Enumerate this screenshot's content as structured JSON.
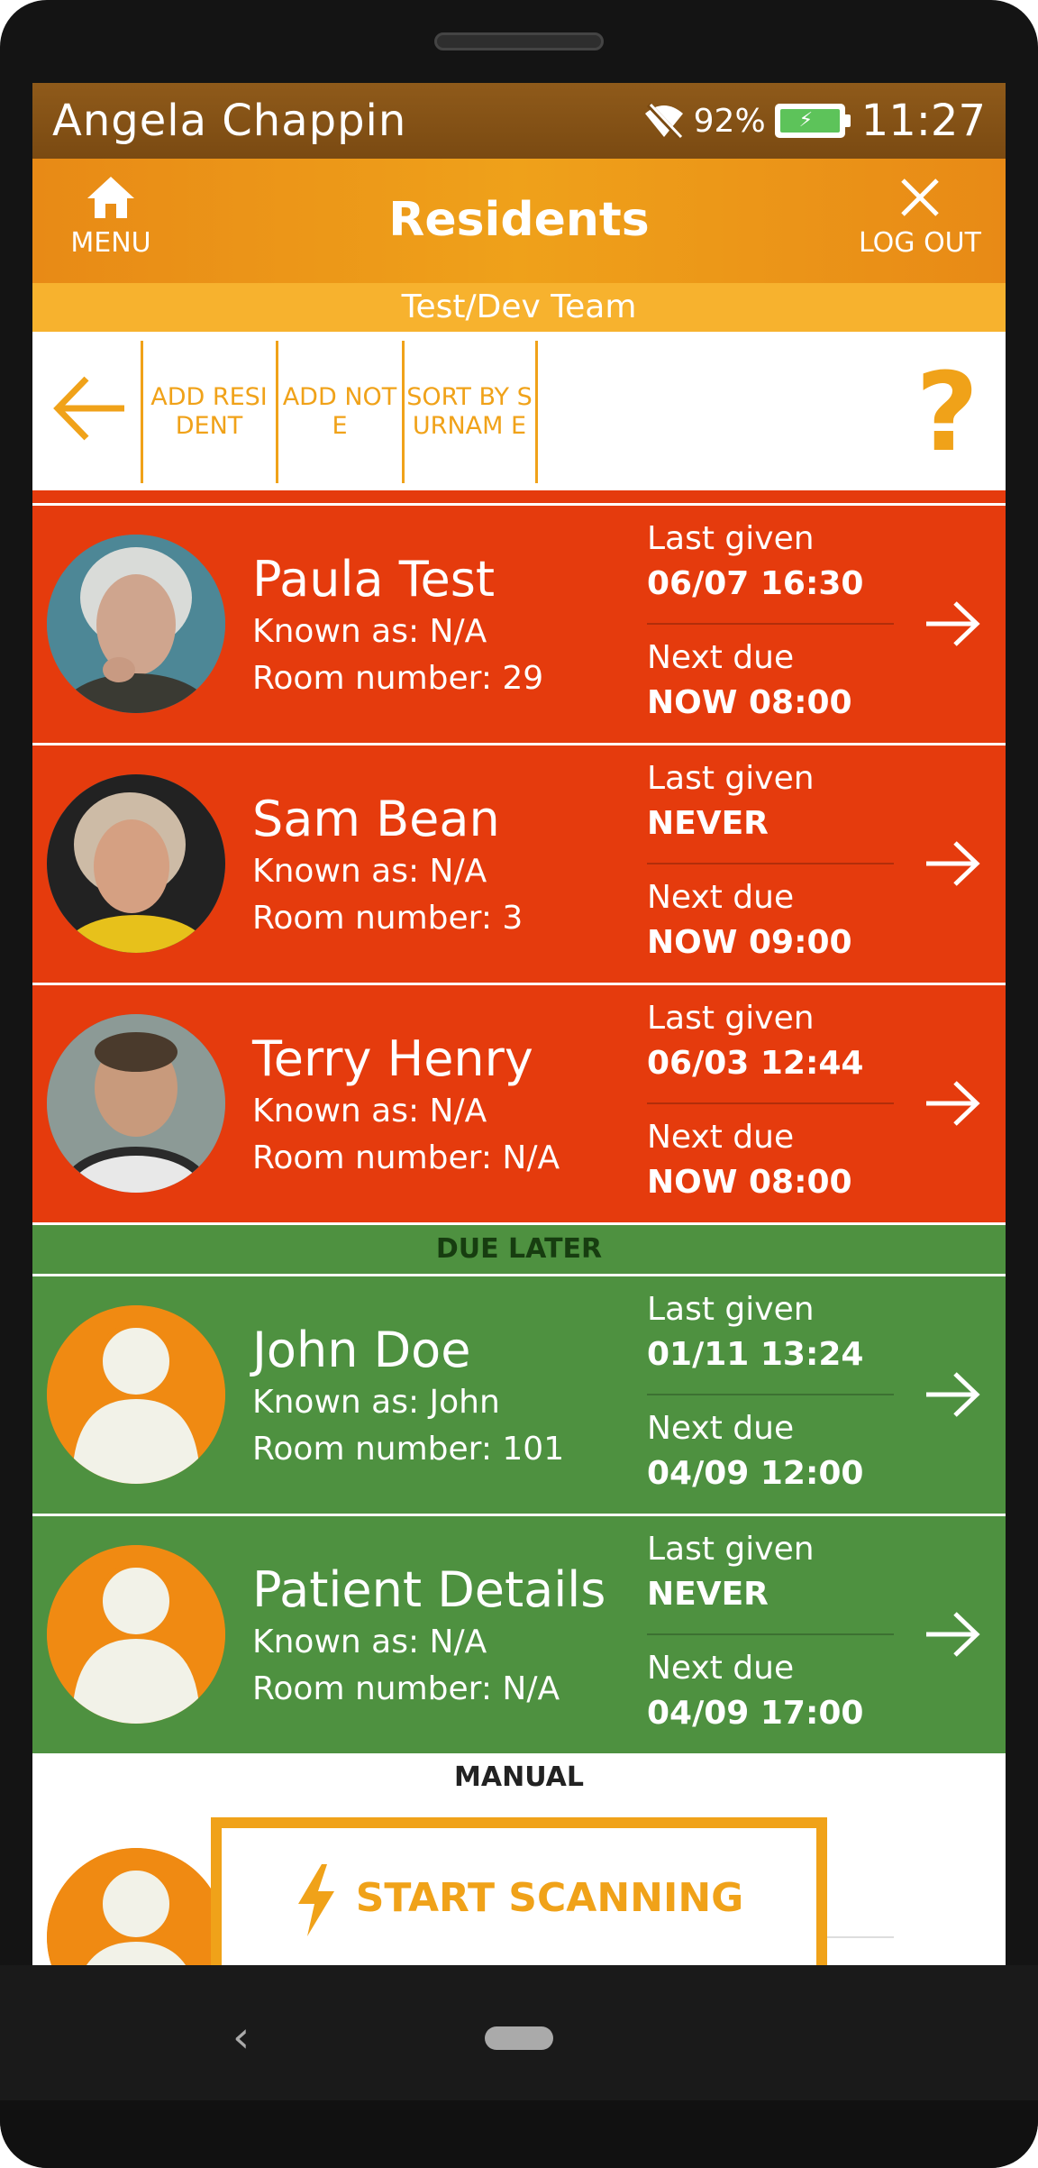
{
  "status_bar": {
    "user_name": "Angela Chappin",
    "battery": "92%",
    "time": "11:27"
  },
  "app_bar": {
    "menu_label": "MENU",
    "title": "Residents",
    "logout_label": "LOG OUT"
  },
  "team_label": "Test/Dev Team",
  "toolbar": {
    "add_resident": "ADD RESI DENT",
    "add_note": "ADD NOTE",
    "sort_by_surname": "SORT BY SURNAM E",
    "help": "?"
  },
  "overdue": [
    {
      "name": "Paula Test",
      "known_as": "Known as: N/A",
      "room": "Room number: 29",
      "last_given_label": "Last given",
      "last_given": "06/07 16:30",
      "next_due_label": "Next due",
      "next_due": "NOW 08:00"
    },
    {
      "name": "Sam Bean",
      "known_as": "Known as: N/A",
      "room": "Room number: 3",
      "last_given_label": "Last given",
      "last_given": "NEVER",
      "next_due_label": "Next due",
      "next_due": "NOW 09:00"
    },
    {
      "name": "Terry Henry",
      "known_as": "Known as: N/A",
      "room": "Room number: N/A",
      "last_given_label": "Last given",
      "last_given": "06/03 12:44",
      "next_due_label": "Next due",
      "next_due": "NOW 08:00"
    }
  ],
  "due_later_header": "DUE LATER",
  "due_later": [
    {
      "name": "John Doe",
      "known_as": "Known as: John",
      "room": "Room number: 101",
      "last_given_label": "Last given",
      "last_given": "01/11 13:24",
      "next_due_label": "Next due",
      "next_due": "04/09 12:00"
    },
    {
      "name": "Patient Details",
      "known_as": "Known as: N/A",
      "room": "Room number: N/A",
      "last_given_label": "Last given",
      "last_given": "NEVER",
      "next_due_label": "Next due",
      "next_due": "04/09 17:00"
    }
  ],
  "manual_header": "MANUAL",
  "start_scanning": "START SCANNING",
  "colors": {
    "overdue": "#e53b0d",
    "due_later": "#4e9140",
    "accent": "#f0a219"
  }
}
